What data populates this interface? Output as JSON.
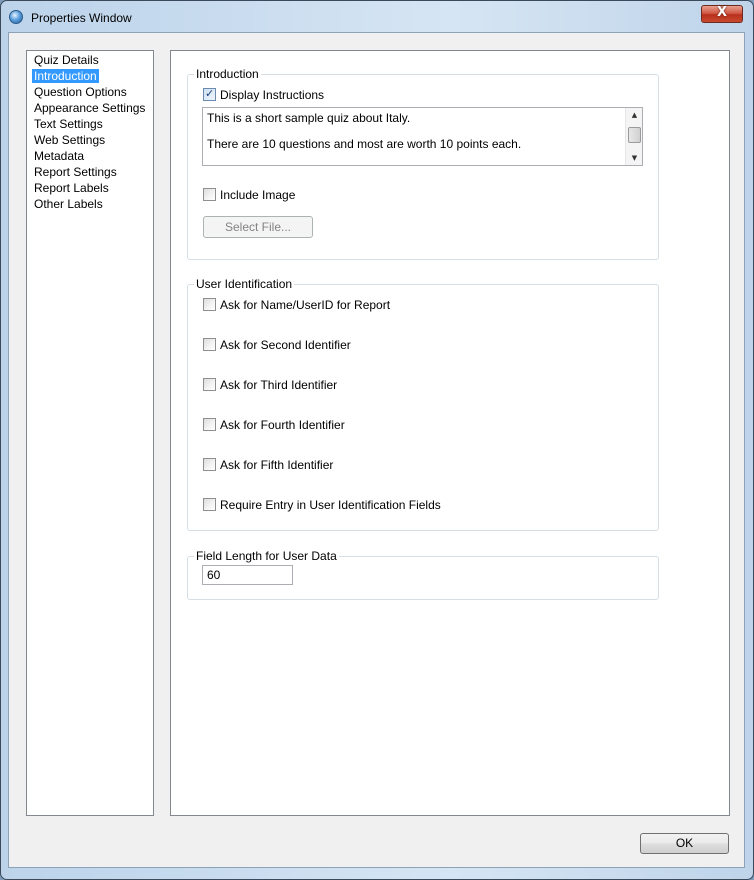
{
  "window": {
    "title": "Properties Window",
    "close_label": "X",
    "icon": "app-globe-icon"
  },
  "sidebar": {
    "items": [
      {
        "label": "Quiz Details",
        "selected": false
      },
      {
        "label": "Introduction",
        "selected": true
      },
      {
        "label": "Question Options",
        "selected": false
      },
      {
        "label": "Appearance Settings",
        "selected": false
      },
      {
        "label": "Text Settings",
        "selected": false
      },
      {
        "label": "Web Settings",
        "selected": false
      },
      {
        "label": "Metadata",
        "selected": false
      },
      {
        "label": "Report Settings",
        "selected": false
      },
      {
        "label": "Report Labels",
        "selected": false
      },
      {
        "label": "Other Labels",
        "selected": false
      }
    ]
  },
  "introduction": {
    "group_label": "Introduction",
    "display_instructions": {
      "label": "Display Instructions",
      "checked": true
    },
    "instructions_text": {
      "line1": "This is a short sample quiz about Italy.",
      "line2": "There are 10 questions and most are worth 10 points each."
    },
    "include_image": {
      "label": "Include Image",
      "checked": false
    },
    "select_file_label": "Select File..."
  },
  "user_identification": {
    "group_label": "User Identification",
    "options": [
      {
        "label": "Ask for Name/UserID for Report",
        "checked": false
      },
      {
        "label": "Ask for Second Identifier",
        "checked": false
      },
      {
        "label": "Ask for Third Identifier",
        "checked": false
      },
      {
        "label": "Ask for Fourth Identifier",
        "checked": false
      },
      {
        "label": "Ask for Fifth Identifier",
        "checked": false
      },
      {
        "label": "Require Entry in User Identification Fields",
        "checked": false
      }
    ]
  },
  "field_length": {
    "group_label": "Field Length for User Data",
    "value": "60"
  },
  "footer": {
    "ok_label": "OK"
  }
}
